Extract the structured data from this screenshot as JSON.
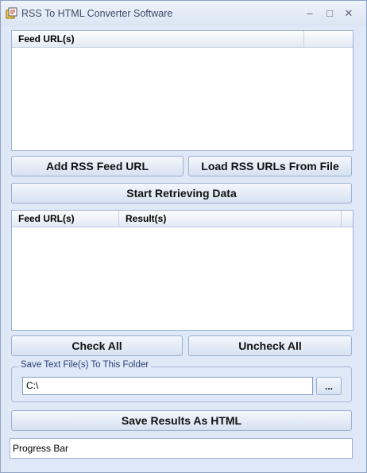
{
  "window": {
    "title": "RSS To HTML Converter Software",
    "minimize": "–",
    "maximize": "□",
    "close": "✕"
  },
  "feeds_list": {
    "column_header": "Feed URL(s)"
  },
  "buttons": {
    "add_feed": "Add RSS Feed URL",
    "load_from_file": "Load RSS URLs From File",
    "start": "Start Retrieving Data",
    "check_all": "Check All",
    "uncheck_all": "Uncheck All",
    "browse": "...",
    "save_html": "Save Results As HTML"
  },
  "results_list": {
    "columns": [
      "Feed URL(s)",
      "Result(s)"
    ]
  },
  "save_folder": {
    "label": "Save Text File(s) To This Folder",
    "value": "C:\\"
  },
  "status": {
    "progress_text": "Progress Bar"
  },
  "colors": {
    "window_bg": "#dfe8f6",
    "border": "#9fb2d1",
    "group_label": "#2b3f76"
  }
}
